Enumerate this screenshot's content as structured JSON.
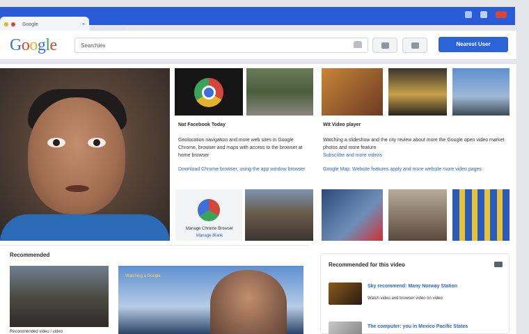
{
  "tab": {
    "title": "Google",
    "close": "×"
  },
  "header": {
    "logo_letters": [
      "G",
      "o",
      "o",
      "g",
      "l",
      "e"
    ],
    "search_value": "Searchlev",
    "button_label": "Nearest User"
  },
  "mid": {
    "heading": "Nat Facebook Today",
    "text": "Geolocation navigation and more web sites in Google Chrome, browser and maps with access to the browser at home browser",
    "link": "Download Chrome browser, using the app window browser",
    "bottom_caption": "Manage Chrome Browser",
    "bottom_link": "Manage Blank"
  },
  "right": {
    "heading": "Wit Video player",
    "text": "Watching a slideshow and the city review about more the Google open video market photos and more feature",
    "text_link": "Subscribe and more videos",
    "link": "Google Map: Website features apply and more website more video pages"
  },
  "bottom": {
    "heading": "Recommended",
    "caption": "Recommended video / video",
    "image_caption": "Watching a Google"
  },
  "sidebar": {
    "title": "Recommended for this video",
    "items": [
      {
        "title": "Sky recommend: Many Norway Station",
        "meta": "Watch video and browser video on video"
      },
      {
        "title": "The computer: you in Mexico Pacific States",
        "meta": ""
      }
    ]
  },
  "colors": {
    "brand_blue": "#2b63d8",
    "chrome_blue": "#2a5bd7",
    "link": "#2b63d8"
  }
}
